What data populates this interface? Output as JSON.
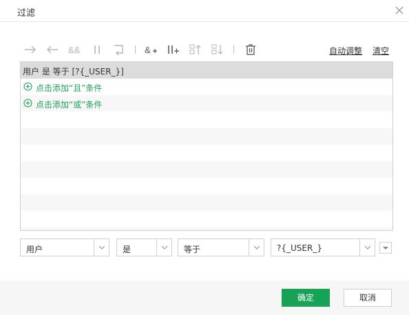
{
  "dialog": {
    "title": "过滤",
    "close_icon": "close-icon"
  },
  "toolbar": {
    "icons": [
      "indent-right-arrow-icon",
      "outdent-left-arrow-icon",
      "and-operator-icon",
      "or-operator-icon",
      "undo-return-icon",
      "add-and-condition-icon",
      "add-or-condition-icon",
      "move-up-icon",
      "move-down-icon",
      "trash-icon"
    ],
    "auto_adjust_label": "自动调整",
    "clear_label": "清空"
  },
  "filter": {
    "condition_text": "用户 是 等于 [?{_USER_}]",
    "add_and_label": "点击添加“且”条件",
    "add_or_label": "点击添加“或”条件"
  },
  "editor": {
    "field_value": "用户",
    "negation_value": "是",
    "operator_value": "等于",
    "value_value": "?{_USER_}"
  },
  "footer": {
    "ok_label": "确定",
    "cancel_label": "取消"
  },
  "colors": {
    "accent_green": "#17a356",
    "add_link_green": "#1aa35a",
    "selected_row": "#dcdcdc",
    "stripe_row": "#f7f7f7"
  }
}
